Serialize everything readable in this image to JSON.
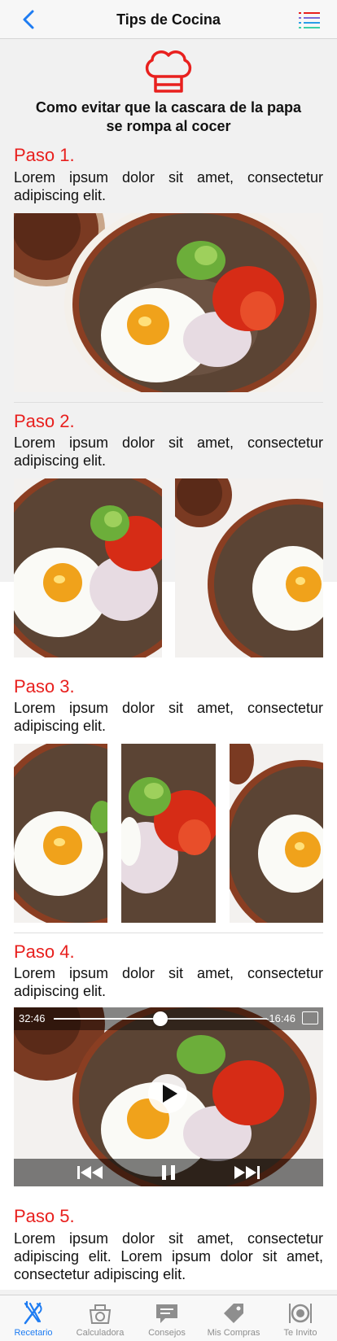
{
  "nav": {
    "title": "Tips de Cocina"
  },
  "article": {
    "title_line1": "Como evitar que la cascara de la papa",
    "title_line2": "se rompa al cocer"
  },
  "steps": [
    {
      "title": "Paso 1.",
      "text": "Lorem ipsum dolor sit amet, consectetur adipiscing elit."
    },
    {
      "title": "Paso 2.",
      "text": "Lorem ipsum dolor sit amet, consectetur adipiscing elit."
    },
    {
      "title": "Paso 3.",
      "text": "Lorem ipsum dolor sit amet, consectetur adipiscing elit."
    },
    {
      "title": "Paso 4.",
      "text": "Lorem ipsum dolor sit amet, consectetur adipiscing elit."
    },
    {
      "title": "Paso 5.",
      "text": "Lorem ipsum dolor sit amet, consectetur adipiscing elit. Lorem ipsum dolor sit amet, consectetur adipiscing elit."
    }
  ],
  "video": {
    "elapsed": "32:46",
    "remaining": "-16:46",
    "progress": 0.5
  },
  "tabs": [
    {
      "label": "Recetario",
      "icon": "fork-knife-icon",
      "active": true
    },
    {
      "label": "Calculadora",
      "icon": "scale-icon",
      "active": false
    },
    {
      "label": "Consejos",
      "icon": "chat-bubble-icon",
      "active": false
    },
    {
      "label": "Mis Compras",
      "icon": "tag-icon",
      "active": false
    },
    {
      "label": "Te Invito",
      "icon": "plate-icon",
      "active": false
    }
  ],
  "colors": {
    "accent": "#e8201e",
    "tab_active": "#1e7cf2",
    "tab_inactive": "#8e8e8e"
  }
}
